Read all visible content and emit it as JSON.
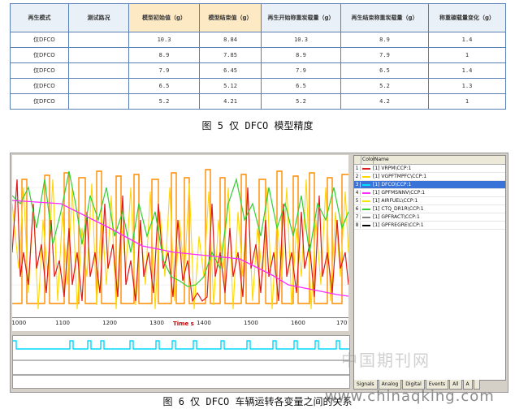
{
  "table": {
    "headers": [
      "再生模式",
      "测试路况",
      "模型初始值（g）",
      "模型结束值（g）",
      "再生开始称重炭载量（g）",
      "再生结束称重炭载量（g）",
      "称重碳载量变化（g）"
    ],
    "rows": [
      {
        "mode": "仅DFCO",
        "road": "",
        "init": "10.3",
        "end": "8.84",
        "wstart": "10.3",
        "wend": "8.9",
        "delta": "1.4"
      },
      {
        "mode": "仅DFCO",
        "road": "",
        "init": "8.9",
        "end": "7.85",
        "wstart": "8.9",
        "wend": "7.9",
        "delta": "1"
      },
      {
        "mode": "仅DFCO",
        "road": "",
        "init": "7.9",
        "end": "6.45",
        "wstart": "7.9",
        "wend": "6.5",
        "delta": "1.4"
      },
      {
        "mode": "仅DFCO",
        "road": "",
        "init": "6.5",
        "end": "5.12",
        "wstart": "6.5",
        "wend": "5.2",
        "delta": "1.3"
      },
      {
        "mode": "仅DFCO",
        "road": "",
        "init": "5.2",
        "end": "4.21",
        "wstart": "5.2",
        "wend": "4.2",
        "delta": "1"
      }
    ]
  },
  "caption5": "图 5 仅 DFCO 模型精度",
  "figure": {
    "x_ticks": [
      "1000",
      "1100",
      "1200",
      "1300",
      "1400",
      "1500",
      "1600",
      "170"
    ],
    "x_title": "Time s",
    "panel_headers": [
      "",
      "Color",
      "Name"
    ],
    "channels": [
      {
        "id": "1",
        "color": "#e01818",
        "name": "[1] VRPM\\CCP:1"
      },
      {
        "id": "2",
        "color": "#ffd800",
        "name": "[1] VGPFTMPFC\\CCP:1"
      },
      {
        "id": "3",
        "color": "#00e0ff",
        "name": "[1] DFCO\\CCP:1"
      },
      {
        "id": "4",
        "color": "#ff2aff",
        "name": "[1] GPFMSNNV\\CCP:1"
      },
      {
        "id": "5",
        "color": "#ffe200",
        "name": "[1] AIRFUEL\\CCP:1"
      },
      {
        "id": "6",
        "color": "#30d030",
        "name": "[1] CTQ_DR1R\\CCP:1"
      },
      {
        "id": "7",
        "color": "#808080",
        "name": "[1] GPFRACT\\CCP:1"
      },
      {
        "id": "8",
        "color": "#000000",
        "name": "[1] GPFREGRE\\CCP:1"
      }
    ],
    "tabs": [
      "Signals",
      "Analog",
      "Digital",
      "Events",
      "All",
      "A",
      ""
    ]
  },
  "caption6": "图 6 仅 DFCO 车辆运转各变量之间的关系",
  "watermark": {
    "cn": "中国期刊网",
    "url": "www.chinaqking.com"
  }
}
